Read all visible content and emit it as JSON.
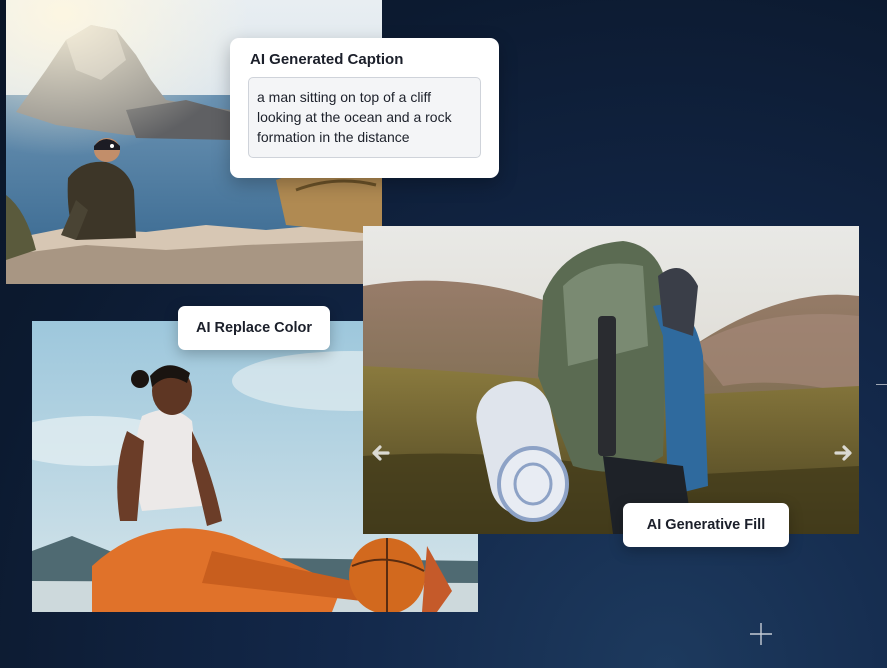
{
  "caption_card": {
    "title": "AI Generated Caption",
    "text": "a man sitting on top of a cliff looking at the ocean and a rock formation in the distance"
  },
  "labels": {
    "replace_color": "AI Replace Color",
    "generative_fill": "AI Generative Fill"
  },
  "icons": {
    "prev": "arrow-left-icon",
    "next": "arrow-right-icon",
    "decoration": "plus-icon"
  },
  "colors": {
    "background": "#0c1a30",
    "card": "#ffffff",
    "text": "#1b1f2a"
  }
}
